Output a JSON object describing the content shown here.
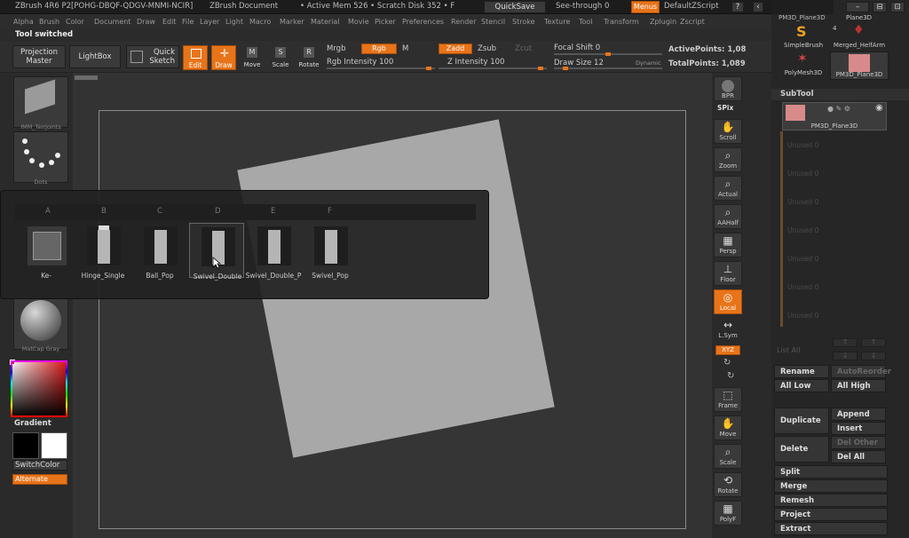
{
  "title_bar": {
    "app": "ZBrush 4R6 P2[POHG-DBQF-QDGV-MNMI-NCIR]",
    "document": "ZBrush Document",
    "mem": "• Active Mem 526 • Scratch Disk 352 • F",
    "quicksave": "QuickSave",
    "seethrough": "See-through 0",
    "menus": "Menus",
    "script": "DefaultZScript"
  },
  "menus": [
    "Alpha",
    "Brush",
    "Color",
    "Document",
    "Draw",
    "Edit",
    "File",
    "Layer",
    "Light",
    "Macro",
    "Marker",
    "Material",
    "Movie",
    "Picker",
    "Preferences",
    "Render",
    "Stencil",
    "Stroke",
    "Texture",
    "Tool",
    "Transform",
    "Zplugin",
    "Zscript"
  ],
  "status": "Tool switched",
  "toolbar": {
    "projection_master": "Projection Master",
    "lightbox": "LightBox",
    "quick_sketch": "Quick Sketch",
    "edit": "Edit",
    "draw": "Draw",
    "move": "Move",
    "scale": "Scale",
    "rotate": "Rotate",
    "mrgb": "Mrgb",
    "rgb": "Rgb",
    "m": "M",
    "rgb_intensity": "Rgb Intensity 100",
    "zadd": "Zadd",
    "zsub": "Zsub",
    "zcut": "Zcut",
    "z_intensity": "Z Intensity 100",
    "focal_shift": "Focal Shift 0",
    "draw_size": "Draw Size 12",
    "dynamic": "Dynamic",
    "active_points": "ActivePoints: 1,08",
    "total_points": "TotalPoints: 1,089"
  },
  "left_shelf": {
    "brush": "IMM_TeirJoints",
    "stroke": "Dots",
    "material": "MatCap Gray",
    "gradient": "Gradient",
    "switch_color": "SwitchColor",
    "alternate": "Alternate"
  },
  "popup": {
    "columns": [
      "A",
      "B",
      "C",
      "D",
      "E",
      "F"
    ],
    "items": [
      "Ke-",
      "Hinge_Single",
      "Ball_Pop",
      "Swivel_Double",
      "Swivel_Double_P",
      "Swivel_Pop"
    ]
  },
  "right_shelf": [
    "BPR",
    "SPix",
    "Scroll",
    "Zoom",
    "Actual",
    "AAHalf",
    "Persp",
    "Floor",
    "Local",
    "L.Sym",
    "XYZ",
    "Frame",
    "Move",
    "Scale",
    "Rotate",
    "PolyF"
  ],
  "sidebar": {
    "top_label": "PM3D_Plane3D",
    "plane3d": "Plane3D",
    "count": "4",
    "tools": [
      "SimpleBrush",
      "Merged_HelfArm",
      "PolyMesh3D",
      "PM3D_Plane3D"
    ],
    "subtool_title": "SubTool",
    "subtool_item": "PM3D_Plane3D",
    "unused": [
      "Unused 0",
      "Unused 0",
      "Unused 0",
      "Unused 0",
      "Unused 0",
      "Unused 0",
      "Unused 0"
    ],
    "list_all": "List All",
    "buttons": [
      "Rename",
      "AutoReorder",
      "All Low",
      "All High",
      "Duplicate",
      "Append",
      "Insert",
      "Delete",
      "Del Other",
      "Del All",
      "Split",
      "Merge",
      "Remesh",
      "Project",
      "Extract"
    ]
  },
  "colors": {
    "accent": "#e8741a"
  }
}
